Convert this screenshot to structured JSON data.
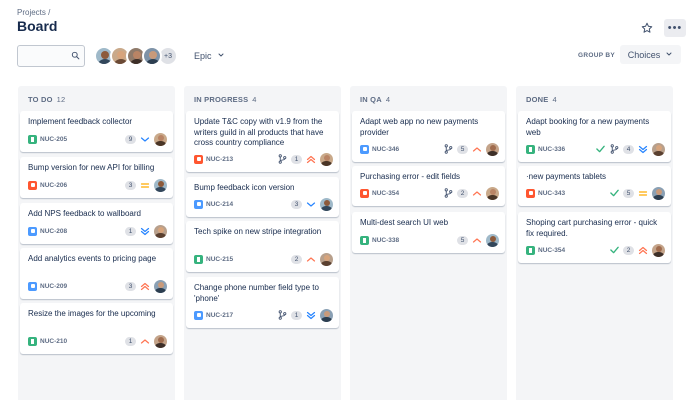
{
  "header": {
    "breadcrumb": "Projects /",
    "title": "Board",
    "star_icon": "star-icon",
    "more_icon": "more-icon",
    "more_label": "•••"
  },
  "toolbar": {
    "search": {
      "value": "",
      "placeholder": "",
      "icon": "search-icon"
    },
    "avatars_more": "+3",
    "epic_label": "Epic",
    "group_by_label": "GROUP BY",
    "group_by_value": "Choices"
  },
  "colors": {
    "story": "#36b37e",
    "bug": "#ff5630",
    "task": "#4c9aff",
    "prio_high": "#ff7452",
    "prio_medium": "#ffab00",
    "prio_low": "#2684ff",
    "done_check": "#36b37e"
  },
  "columns": [
    {
      "title": "TO DO",
      "count": "12",
      "cards": [
        {
          "title": "Implement feedback collector",
          "key": "NUC-205",
          "type": "story",
          "points": "9",
          "priority": "low"
        },
        {
          "title": "Bump version for new API for billing",
          "key": "NUC-206",
          "type": "bug",
          "points": "3",
          "priority": "medium"
        },
        {
          "title": "Add NPS feedback to wallboard",
          "key": "NUC-208",
          "type": "task",
          "points": "1",
          "priority": "lowest"
        },
        {
          "title": "Add analytics events to pricing page",
          "key": "NUC-209",
          "type": "subtask",
          "points": "3",
          "priority": "highest"
        },
        {
          "title": "Resize the images for the upcoming",
          "key": "NUC-210",
          "type": "story",
          "points": "1",
          "priority": "high"
        }
      ]
    },
    {
      "title": "IN PROGRESS",
      "count": "4",
      "cards": [
        {
          "title": "Update T&C copy with v1.9 from the writers guild in all products that have cross country compliance",
          "key": "NUC-213",
          "type": "bug",
          "points": "1",
          "priority": "highest",
          "branch": true
        },
        {
          "title": "Bump feedback icon version",
          "key": "NUC-214",
          "type": "task",
          "points": "3",
          "priority": "low"
        },
        {
          "title": "Tech spike on new stripe integration",
          "key": "NUC-215",
          "type": "story",
          "points": "2",
          "priority": "high"
        },
        {
          "title": "Change phone number field type to 'phone'",
          "key": "NUC-217",
          "type": "task",
          "points": "1",
          "priority": "lowest",
          "branch": true
        }
      ]
    },
    {
      "title": "IN QA",
      "count": "4",
      "cards": [
        {
          "title": "Adapt web app no new payments provider",
          "key": "NUC-346",
          "type": "subtask",
          "points": "5",
          "priority": "high",
          "branch": true
        },
        {
          "title": "Purchasing error - edit fields",
          "key": "NUC-354",
          "type": "bug",
          "points": "2",
          "priority": "high",
          "branch": true
        },
        {
          "title": "Multi-dest search UI web",
          "key": "NUC-338",
          "type": "story",
          "points": "5",
          "priority": "high"
        }
      ]
    },
    {
      "title": "DONE",
      "count": "4",
      "cards": [
        {
          "title": "Adapt  booking for a new payments web",
          "key": "NUC-336",
          "type": "story",
          "points": "4",
          "priority": "lowest",
          "branch": true,
          "done": true
        },
        {
          "title": "·new payments   tablets",
          "key": "NUC-343",
          "type": "bug",
          "points": "5",
          "priority": "medium",
          "done": true
        },
        {
          "title": "Shoping cart purchasing error - quick fix required.",
          "key": "NUC-354",
          "type": "story",
          "points": "2",
          "priority": "highest",
          "done": true
        }
      ]
    }
  ]
}
